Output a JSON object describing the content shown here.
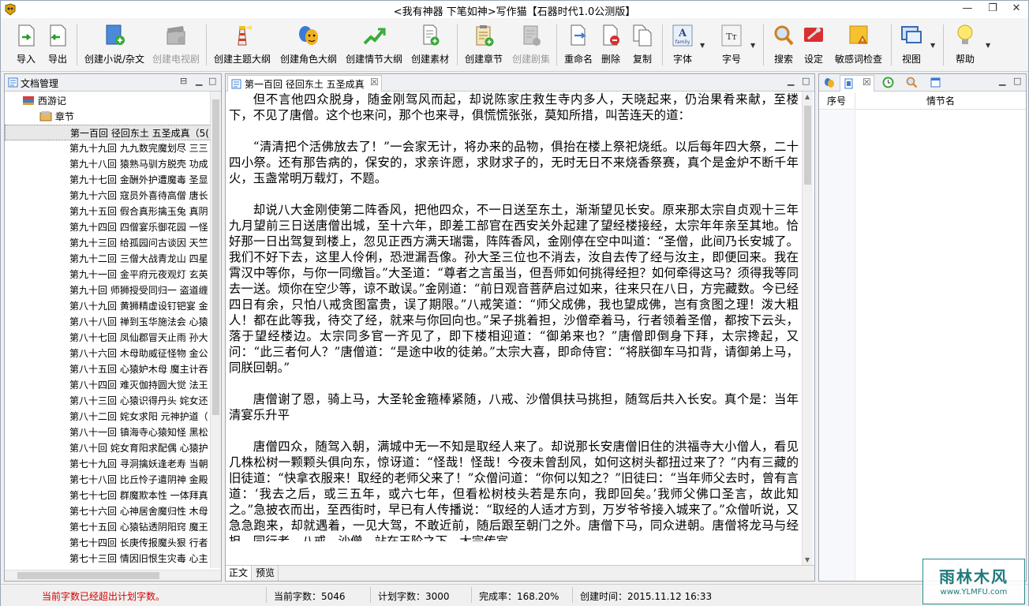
{
  "window": {
    "title": "<我有神器  下笔如神>写作猫【石器时代1.0公测版】",
    "minimize": "—",
    "restore": "❐",
    "close": "✕"
  },
  "toolbar": {
    "import": "导入",
    "export": "导出",
    "create_novel": "创建小说/杂文",
    "create_tv": "创建电视剧",
    "create_theme": "创建主题大纲",
    "create_role": "创建角色大纲",
    "create_plot": "创建情节大纲",
    "create_material": "创建素材",
    "create_chapter": "创建章节",
    "create_episode": "创建剧集",
    "rename": "重命名",
    "delete": "删除",
    "copy": "复制",
    "font": "字体",
    "fontsize": "字号",
    "search": "搜索",
    "settings": "设定",
    "sensitive": "敏感词检查",
    "view": "视图",
    "help": "帮助",
    "font_icon_text": "family",
    "fontsize_icon_text": "Tт"
  },
  "left_panel": {
    "title": "文档管理",
    "book": "西游记",
    "folder": "章节",
    "chapters": [
      "第一百回 径回东土 五圣成真（5(",
      "第九十九回 九九数完魔划尽 三三",
      "第九十八回 猿熟马驯方脱壳 功成",
      "第九十七回 金酬外护遭魔毒 圣显",
      "第九十六回 寇员外喜待高僧 唐长",
      "第九十五回 假合真形擒玉兔 真阴",
      "第九十四回 四僧宴乐御花园 一怪",
      "第九十三回 给孤园问古谈因 天竺",
      "第九十二回 三僧大战青龙山 四星",
      "第九十一回 金平府元夜观灯 玄英",
      "第九十回 师狮授受同归一 盗道缠",
      "第八十九回 黄狮精虚设钉钯宴 金",
      "第八十八回 禅到玉华施法会 心猿",
      "第八十七回 凤仙郡冒天止雨 孙大",
      "第八十六回 木母助威征怪物 金公",
      "第八十五回 心猿妒木母 魔主计吞",
      "第八十四回 难灭伽持圆大觉 法王",
      "第八十三回 心猿识得丹头 姹女还",
      "第八十二回 姹女求阳 元神护道（",
      "第八十一回 镇海寺心猿知怪 黑松",
      "第八十回 姹女育阳求配偶 心猿护",
      "第七十九回 寻洞擒妖逢老寿 当朝",
      "第七十八回 比丘怜子遣阴神 金殿",
      "第七十七回 群魔欺本性 一体拜真",
      "第七十六回 心神居舍魔归性 木母",
      "第七十五回 心猿钻透阴阳窍 魔王",
      "第七十四回 长庚传报魔头狠 行者",
      "第七十三回 情因旧恨生灾毒 心主"
    ]
  },
  "editor": {
    "tab": "第一百回 径回东土 五圣成真",
    "paragraphs": [
      "但不言他四众脱身，随金刚驾风而起，却说陈家庄救生寺内多人，天晓起来，仍治果肴来献，至楼下，不见了唐僧。这个也来问，那个也来寻，俱慌慌张张，莫知所措，叫苦连天的道：",
      "“清清把个活佛放去了！”一会家无计，将办来的品物，俱抬在楼上祭祀烧纸。以后每年四大祭，二十四小祭。还有那告病的，保安的，求亲许愿，求财求子的，无时无日不来烧香祭赛，真个是金炉不断千年火，玉盏常明万载灯，不题。",
      "却说八大金刚使第二阵香风，把他四众，不一日送至东土，渐渐望见长安。原来那太宗自贞观十三年九月望前三日送唐僧出城，至十六年，即差工部官在西安关外起建了望经楼接经，太宗年年亲至其地。恰好那一日出驾复到楼上，忽见正西方满天瑞霭，阵阵香风，金刚停在空中叫道：“圣僧，此间乃长安城了。我们不好下去，这里人伶俐，恐泄漏吾像。孙大圣三位也不消去，汝自去传了经与汝主，即便回来。我在霄汉中等你，与你一同缴旨。”大圣道：“尊者之言虽当，但吾师如何挑得经担？如何牵得这马？须得我等同去一送。烦你在空少等，谅不敢误。”金刚道：“前日观音菩萨启过如来，往来只在八日，方完藏数。今已经四日有余，只怕八戒贪图富贵，误了期限。”八戒笑道：“师父成佛，我也望成佛，岂有贪图之理！泼大粗人！都在此等我，待交了经，就来与你回向也。”呆子挑着担，沙僧牵着马，行者领着圣僧，都按下云头，落于望经楼边。太宗同多官一齐见了，即下楼相迎道：“御弟来也？”唐僧即倒身下拜，太宗搀起，又问：“此三者何人？”唐僧道：“是途中收的徒弟。”太宗大喜，即命侍官：“将朕御车马扣背，请御弟上马，同朕回朝。”",
      "唐僧谢了恩，骑上马，大圣轮金箍棒紧随，八戒、沙僧俱扶马挑担，随驾后共入长安。真个是：当年清宴乐升平",
      "唐僧四众，随驾入朝，满城中无一不知是取经人来了。却说那长安唐僧旧住的洪福寺大小僧人，看见几株松树一颗颗头俱向东，惊讶道：“怪哉！怪哉！今夜未曾刮风，如何这树头都扭过来了？”内有三藏的旧徒道：“快拿衣服来！取经的老师父来了！”众僧问道：“你何以知之？”旧徒曰：“当年师父去时，曾有言道：‘我去之后，或三五年，或六七年，但看松树枝头若是东向，我即回矣。’我师父佛口圣言，故此知之。”急披衣而出，至西街时，早已有人传播说：“取经的人适才方到，万岁爷爷接入城来了。”众僧听说，又急急跑来，却就遇着，一见大驾，不敢近前，随后跟至朝门之外。唐僧下马，同众进朝。唐僧将龙马与经担，同行者、八戒、沙僧，站在玉阶之下。太宗传宣"
    ],
    "tab_text": "正文",
    "tab_preview": "预览"
  },
  "right_panel": {
    "col_no": "序号",
    "col_name": "情节名"
  },
  "status": {
    "warning": "当前字数已经超出计划字数。",
    "current_words": "当前字数：5046",
    "plan_words": "计划字数：3000",
    "completion": "完成率：168.20%",
    "created": "创建时间：2015.11.12 16:33"
  },
  "watermark": {
    "name": "雨林木风",
    "url": "www.YLMFU.com"
  },
  "colors": {
    "warning_text": "#d40000",
    "accent": "#3a7bd5",
    "selected_row": "#e8e8e8"
  }
}
